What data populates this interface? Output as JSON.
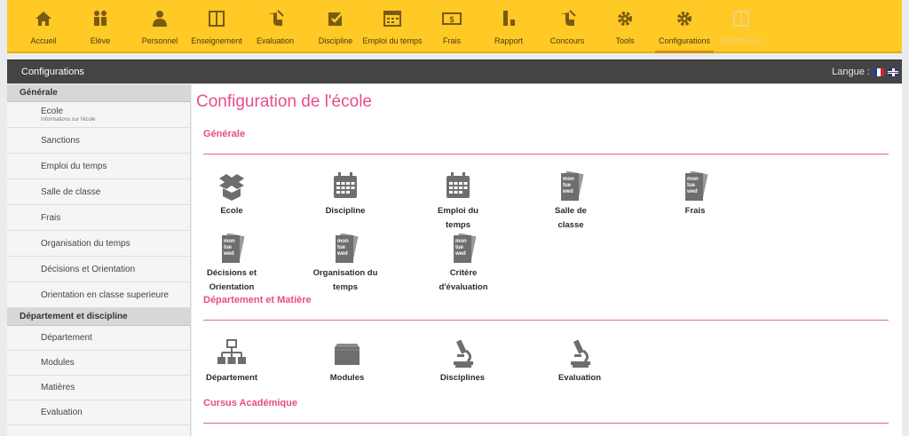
{
  "topnav": {
    "items": [
      {
        "label": "Accueil",
        "icon": "home-icon"
      },
      {
        "label": "Elève",
        "icon": "students-icon"
      },
      {
        "label": "Personnel",
        "icon": "person-icon"
      },
      {
        "label": "Enseignement",
        "icon": "book-icon"
      },
      {
        "label": "Evaluation",
        "icon": "hand-pen-icon"
      },
      {
        "label": "Discipline",
        "icon": "checkbox-icon"
      },
      {
        "label": "Emploi du temps",
        "icon": "calendar-grid-icon"
      },
      {
        "label": "Frais",
        "icon": "money-icon"
      },
      {
        "label": "Rapport",
        "icon": "report-icon"
      },
      {
        "label": "Concours",
        "icon": "hand-pen-icon"
      },
      {
        "label": "Tools",
        "icon": "gear-icon"
      },
      {
        "label": "Configurations",
        "icon": "gear-icon"
      },
      {
        "label": "Bibliothèque",
        "icon": "library-icon"
      }
    ],
    "active": "Configurations"
  },
  "header": {
    "title": "Configurations",
    "language_label": "Langue :"
  },
  "sidebar": {
    "sections": [
      {
        "title": "Générale",
        "items": [
          {
            "label": "Ecole",
            "sub": "Informations sur l'école"
          },
          {
            "label": "Sanctions"
          },
          {
            "label": "Emploi du temps"
          },
          {
            "label": "Salle de classe"
          },
          {
            "label": "Frais"
          },
          {
            "label": "Organisation du temps"
          },
          {
            "label": "Décisions et Orientation"
          },
          {
            "label": "Orientation en classe superieure"
          }
        ]
      },
      {
        "title": "Département et discipline",
        "items": [
          {
            "label": "Département"
          },
          {
            "label": "Modules"
          },
          {
            "label": "Matières"
          },
          {
            "label": "Evaluation"
          }
        ]
      }
    ]
  },
  "main": {
    "title": "Configuration de l'école",
    "sections": [
      {
        "title": "Générale",
        "tiles": [
          {
            "label": "Ecole",
            "icon": "box-icon"
          },
          {
            "label": "Discipline",
            "icon": "calendar-icon"
          },
          {
            "label": "Emploi du temps",
            "icon": "calendar-icon"
          },
          {
            "label": "Salle de classe",
            "icon": "weekday-icon"
          },
          {
            "label": "Frais",
            "icon": "weekday-icon"
          },
          {
            "label": "Décisions et Orientation",
            "icon": "weekday-icon"
          },
          {
            "label": "Organisation du temps",
            "icon": "weekday-icon"
          },
          {
            "label": "Critère d'évaluation",
            "icon": "weekday-icon"
          }
        ]
      },
      {
        "title": "Département et Matière",
        "tiles": [
          {
            "label": "Département",
            "icon": "org-chart-icon"
          },
          {
            "label": "Modules",
            "icon": "folder-icon"
          },
          {
            "label": "Disciplines",
            "icon": "microscope-icon"
          },
          {
            "label": "Evaluation",
            "icon": "microscope-icon"
          }
        ]
      },
      {
        "title": "Cursus Académique",
        "tiles": []
      }
    ],
    "weekday_icon_text": [
      "mon",
      "tue",
      "wed"
    ]
  },
  "colors": {
    "topbar": "#ffc926",
    "accent": "#e84b8a",
    "headbar": "#444444"
  }
}
